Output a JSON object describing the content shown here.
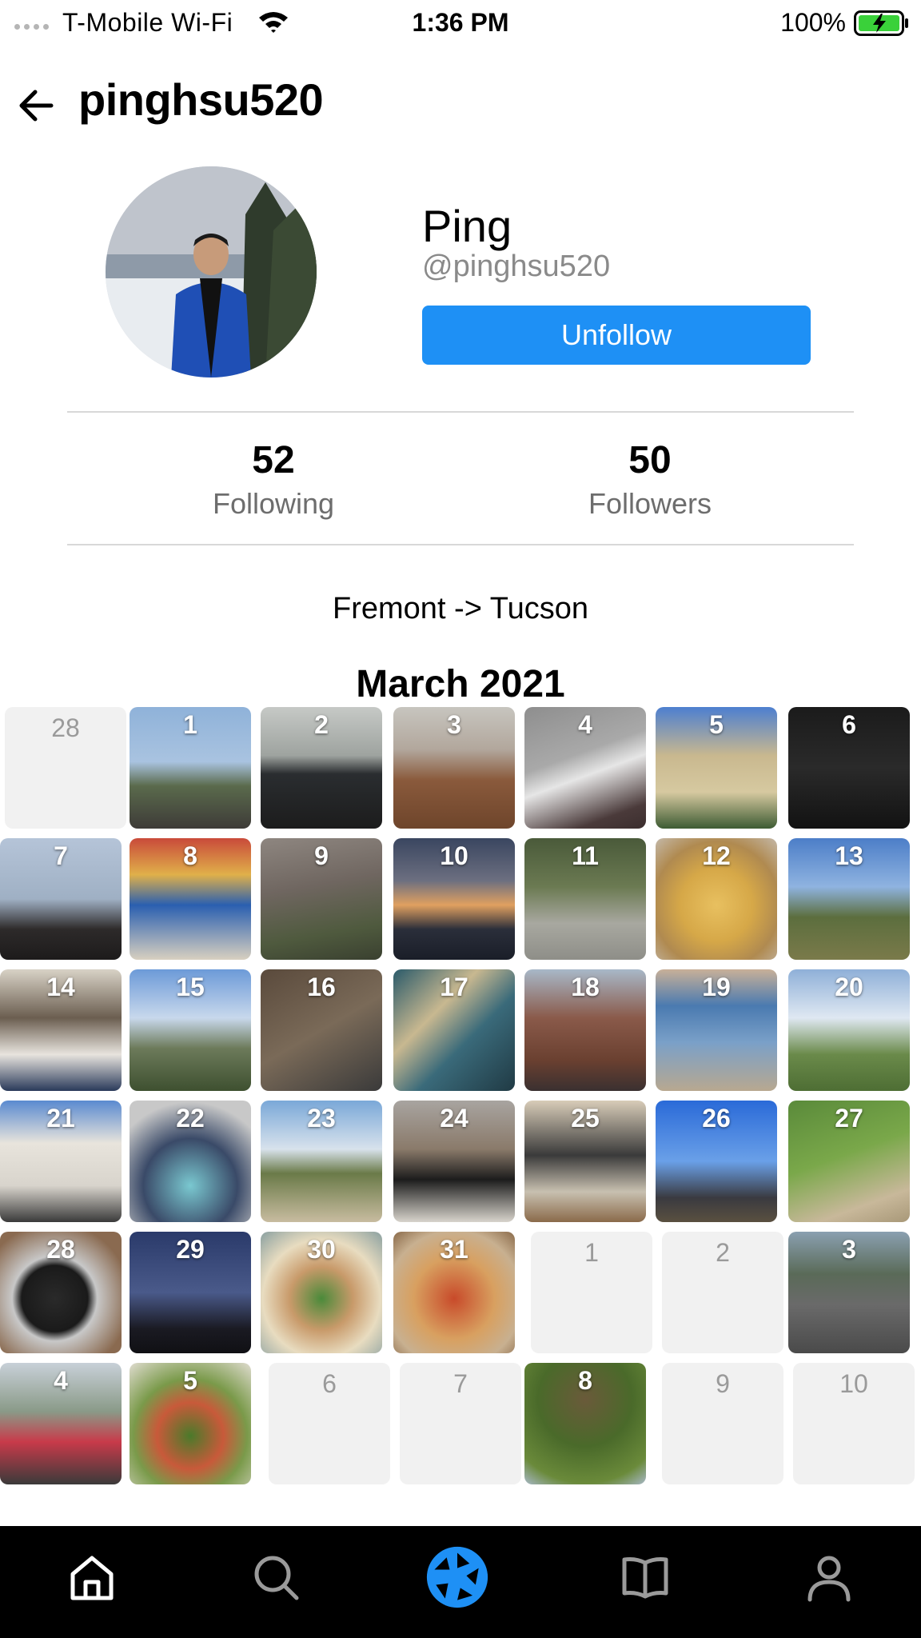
{
  "status_bar": {
    "carrier": "T-Mobile Wi-Fi",
    "time": "1:36 PM",
    "battery": "100%"
  },
  "header": {
    "title": "pinghsu520"
  },
  "profile": {
    "display_name": "Ping",
    "handle": "@pinghsu520",
    "action_label": "Unfollow",
    "following_count": "52",
    "following_label": "Following",
    "followers_count": "50",
    "followers_label": "Followers",
    "bio": "Fremont -> Tucson"
  },
  "calendar": {
    "title": "March 2021",
    "rows": [
      [
        "28",
        "1",
        "2",
        "3",
        "4",
        "5",
        "6"
      ],
      [
        "7",
        "8",
        "9",
        "10",
        "11",
        "12",
        "13"
      ],
      [
        "14",
        "15",
        "16",
        "17",
        "18",
        "19",
        "20"
      ],
      [
        "21",
        "22",
        "23",
        "24",
        "25",
        "26",
        "27"
      ],
      [
        "28",
        "29",
        "30",
        "31",
        "1",
        "2",
        "3"
      ],
      [
        "4",
        "5",
        "6",
        "7",
        "8",
        "9",
        "10"
      ]
    ]
  },
  "tab_bar": {
    "tabs": [
      "home-icon",
      "search-icon",
      "camera-aperture-icon",
      "book-icon",
      "profile-icon"
    ],
    "active_color": "#1e90f5",
    "inactive_color": "#ffffff"
  },
  "colors": {
    "accent": "#1e90f5",
    "battery": "#3ad13a"
  }
}
